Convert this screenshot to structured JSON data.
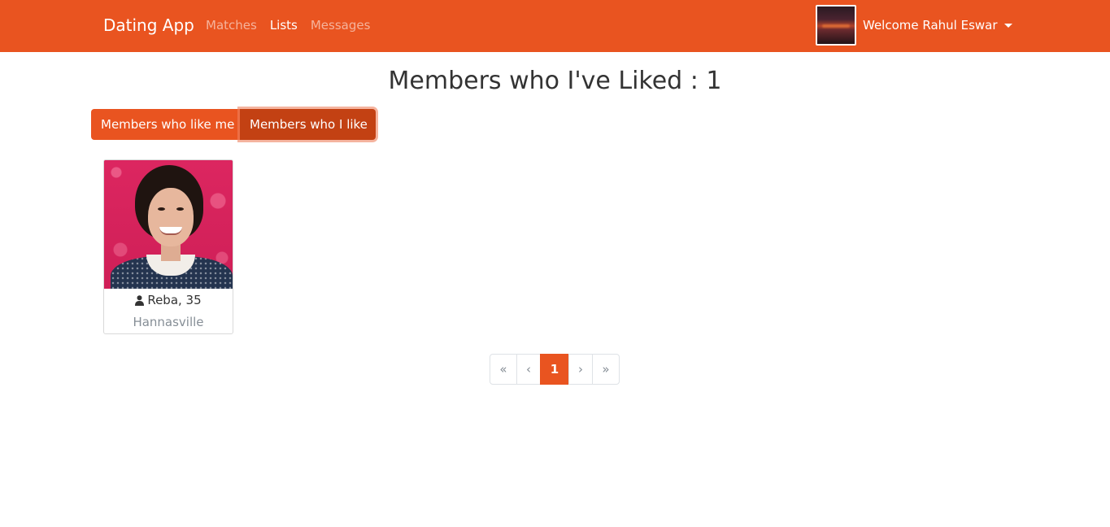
{
  "navbar": {
    "brand": "Dating App",
    "links": [
      {
        "label": "Matches",
        "active": false
      },
      {
        "label": "Lists",
        "active": true
      },
      {
        "label": "Messages",
        "active": false
      }
    ],
    "welcome": "Welcome Rahul Eswar",
    "accent_color": "#E95420"
  },
  "page": {
    "title": "Members who I've Liked : 1"
  },
  "filters": {
    "like_me_label": "Members who like me",
    "i_like_label": "Members who I like",
    "selected": "Members who I like"
  },
  "members": [
    {
      "name": "Reba, 35",
      "city": "Hannasville",
      "icon": "user-icon"
    }
  ],
  "pagination": {
    "first": "«",
    "prev": "‹",
    "current": "1",
    "next": "›",
    "last": "»"
  }
}
